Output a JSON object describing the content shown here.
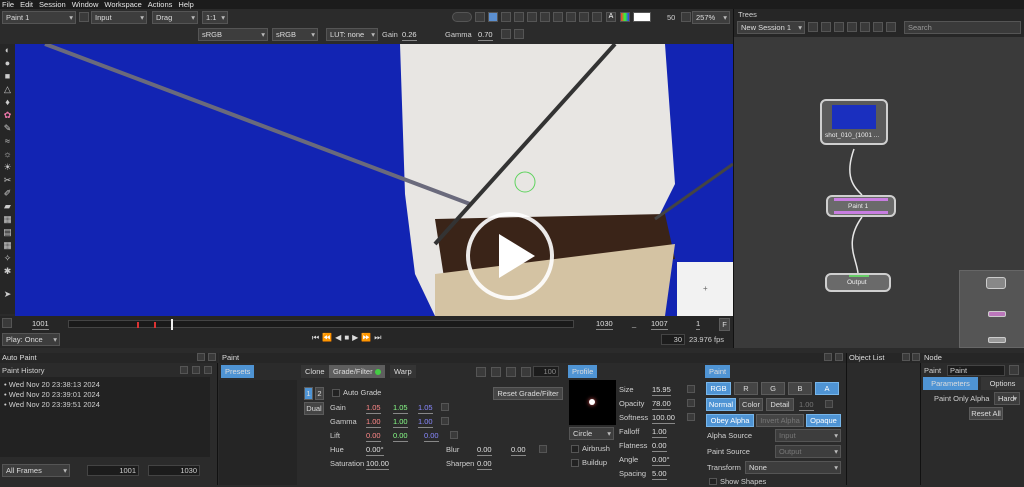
{
  "menu": [
    "File",
    "Edit",
    "Session",
    "Window",
    "Workspace",
    "Actions",
    "Help"
  ],
  "viewer_top": {
    "paint_select": "Paint 1",
    "input_select": "Input",
    "drag_select": "Drag",
    "ratio_select": "1:1",
    "cs1": "sRGB",
    "cs2": "sRGB",
    "lut": "LUT: none",
    "gain_label": "Gain",
    "gain_value": "0.26",
    "gamma_label": "Gamma",
    "gamma_value": "0.70",
    "exposure_value": "50",
    "zoom": "257%"
  },
  "timeline": {
    "start": "1001",
    "current": "1030",
    "end": "1007",
    "step": "1",
    "f_label": "F",
    "play_mode": "Play: Once",
    "frame_count": "30",
    "fps": "23.976 fps"
  },
  "trees": {
    "title": "Trees",
    "session": "New Session 1",
    "search_placeholder": "Search",
    "nodes": [
      "shot_010_(1001 ...",
      "Paint 1",
      "Output"
    ]
  },
  "auto_paint": {
    "title": "Auto Paint",
    "history_title": "Paint History",
    "history": [
      "Wed Nov 20 23:38:13 2024",
      "Wed Nov 20 23:39:01 2024",
      "Wed Nov 20 23:39:51 2024"
    ],
    "frames_select": "All Frames",
    "from": "1001",
    "to": "1030"
  },
  "paint": {
    "title": "Paint",
    "presets": "Presets",
    "tabs": [
      "Clone",
      "Grade/Filter",
      "Warp"
    ],
    "opacity_field": "100",
    "profile_tab": "Profile",
    "auto_grade": "Auto Grade",
    "reset_grade": "Reset Grade/Filter",
    "num1": "1",
    "num2": "2",
    "dual": "Dual",
    "gain_label": "Gain",
    "gain": [
      "1.05",
      "1.05",
      "1.05"
    ],
    "gamma_label": "Gamma",
    "gamma": [
      "1.00",
      "1.00",
      "1.00"
    ],
    "lift_label": "Lift",
    "lift": [
      "0.00",
      "0.00",
      "0.00"
    ],
    "hue_label": "Hue",
    "hue": "0.00°",
    "blur_label": "Blur",
    "blur": [
      "0.00",
      "0.00"
    ],
    "sat_label": "Saturation",
    "sat": "100.00",
    "sharpen_label": "Sharpen",
    "sharpen": "0.00",
    "shape": "Circle",
    "airbrush": "Airbrush",
    "buildup": "Buildup",
    "size_label": "Size",
    "size": "15.95",
    "opacity_label": "Opacity",
    "opacity": "78.00",
    "softness_label": "Softness",
    "softness": "100.00",
    "falloff_label": "Falloff",
    "falloff": "1.00",
    "flatness_label": "Flatness",
    "flatness": "0.00",
    "angle_label": "Angle",
    "angle": "0.00°",
    "spacing_label": "Spacing",
    "spacing": "5.00"
  },
  "paint_right": {
    "title": "Paint",
    "channels": [
      "RGB",
      "R",
      "G",
      "B",
      "A"
    ],
    "modes": [
      "Normal",
      "Color",
      "Detail"
    ],
    "detail_val": "1.00",
    "obey_alpha": "Obey Alpha",
    "invert_alpha": "Invert Alpha",
    "opaque": "Opaque",
    "alpha_source_label": "Alpha Source",
    "alpha_source": "Input",
    "paint_source_label": "Paint Source",
    "paint_source": "Output",
    "transform_label": "Transform",
    "transform": "None",
    "show_shapes": "Show Shapes"
  },
  "object_list": {
    "title": "Object List"
  },
  "node": {
    "title": "Node",
    "name_label": "Paint",
    "name_value": "Paint",
    "tabs": [
      "Parameters",
      "Options"
    ],
    "paint_only_alpha": "Paint Only Alpha",
    "mode": "Hard",
    "reset_all": "Reset All"
  }
}
